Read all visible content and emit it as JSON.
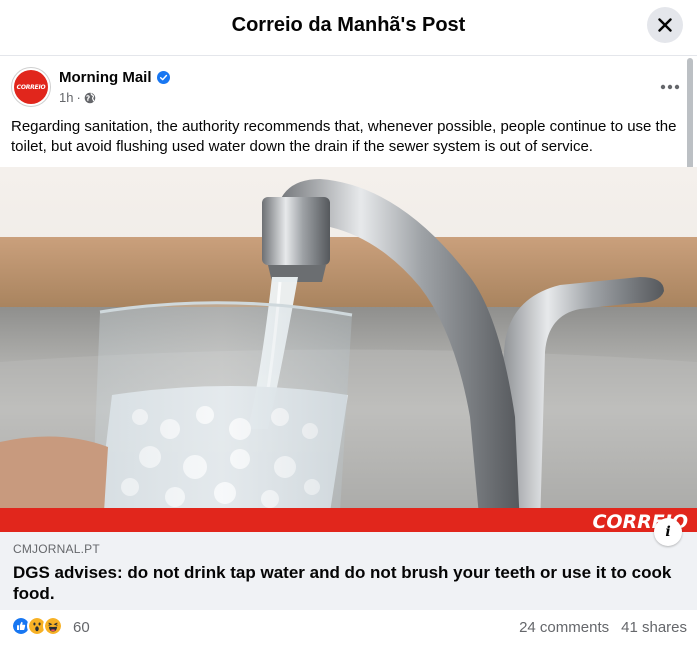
{
  "modal": {
    "title": "Correio da Manhã's Post",
    "close_icon": "close-icon"
  },
  "post": {
    "author": "Morning Mail",
    "verified": true,
    "time": "1h",
    "separator": "·",
    "audience_icon": "globe-icon",
    "avatar_text": "CORREIO",
    "body": "Regarding sanitation, the authority recommends that, whenever possible, people continue to use the toilet, but avoid flushing used water down the drain if the sewer system is out of service."
  },
  "media": {
    "watermark": "CORREIO",
    "brand_color": "#e1261c"
  },
  "link": {
    "domain": "CMJORNAL.PT",
    "title": "DGS advises: do not drink tap water and do not brush your teeth or use it to cook food."
  },
  "engagement": {
    "reactions": [
      "like",
      "wow",
      "haha"
    ],
    "reaction_count": "60",
    "comments": "24 comments",
    "shares": "41 shares"
  },
  "colors": {
    "accent": "#1877f2",
    "secondary_text": "#65676b",
    "preview_bg": "#f0f2f5"
  }
}
